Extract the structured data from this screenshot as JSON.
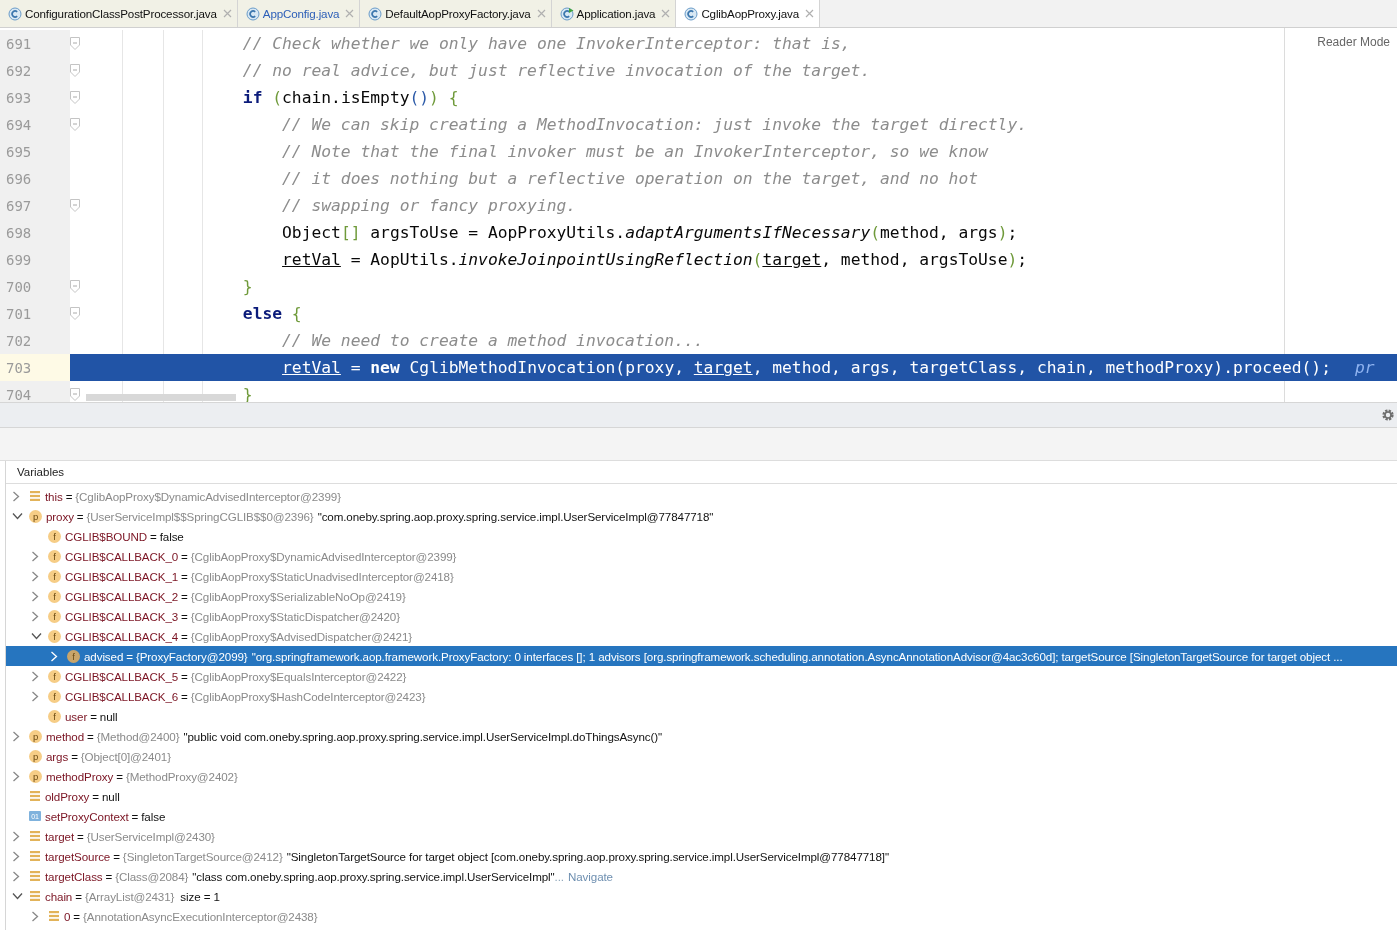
{
  "tabs": [
    {
      "label": "ConfigurationClassPostProcessor.java",
      "kind": "class",
      "modified": false,
      "selected": false
    },
    {
      "label": "AppConfig.java",
      "kind": "class",
      "modified": true,
      "selected": false
    },
    {
      "label": "DefaultAopProxyFactory.java",
      "kind": "class",
      "modified": false,
      "selected": false
    },
    {
      "label": "Application.java",
      "kind": "runnable",
      "modified": false,
      "selected": false
    },
    {
      "label": "CglibAopProxy.java",
      "kind": "class",
      "modified": false,
      "selected": true
    }
  ],
  "editor": {
    "reader_mode": "Reader Mode",
    "lines": [
      {
        "number": "691",
        "fold": true,
        "current": false,
        "tokens": [
          {
            "kind": "comment",
            "text": "                // Check whether we only have one InvokerInterceptor: that is,"
          }
        ]
      },
      {
        "number": "692",
        "fold": true,
        "current": false,
        "tokens": [
          {
            "kind": "comment",
            "text": "                // no real advice, but just reflective invocation of the target."
          }
        ]
      },
      {
        "number": "693",
        "fold": true,
        "current": false,
        "tokens": [
          {
            "kind": "keyword",
            "text": "                if"
          },
          {
            "kind": "brace",
            "text": " ("
          },
          {
            "kind": "plain",
            "text": "chain.isEmpty"
          },
          {
            "kind": "paren",
            "text": "()"
          },
          {
            "kind": "brace",
            "text": ") {"
          }
        ]
      },
      {
        "number": "694",
        "fold": true,
        "current": false,
        "tokens": [
          {
            "kind": "comment",
            "text": "                    // We can skip creating a MethodInvocation: just invoke the target directly."
          }
        ]
      },
      {
        "number": "695",
        "fold": false,
        "current": false,
        "tokens": [
          {
            "kind": "comment",
            "text": "                    // Note that the final invoker must be an InvokerInterceptor, so we know"
          }
        ]
      },
      {
        "number": "696",
        "fold": false,
        "current": false,
        "tokens": [
          {
            "kind": "comment",
            "text": "                    // it does nothing but a reflective operation on the target, and no hot"
          }
        ]
      },
      {
        "number": "697",
        "fold": true,
        "current": false,
        "tokens": [
          {
            "kind": "comment",
            "text": "                    // swapping or fancy proxying."
          }
        ]
      },
      {
        "number": "698",
        "fold": false,
        "current": false,
        "tokens": [
          {
            "kind": "plain",
            "text": "                    Object"
          },
          {
            "kind": "brace",
            "text": "[]"
          },
          {
            "kind": "plain",
            "text": " argsToUse = AopProxyUtils."
          },
          {
            "kind": "method",
            "text": "adaptArgumentsIfNecessary"
          },
          {
            "kind": "brace",
            "text": "("
          },
          {
            "kind": "plain",
            "text": "method, args"
          },
          {
            "kind": "brace",
            "text": ")"
          },
          {
            "kind": "plain",
            "text": ";"
          }
        ]
      },
      {
        "number": "699",
        "fold": false,
        "current": false,
        "tokens": [
          {
            "kind": "field",
            "text": "                    retVal"
          },
          {
            "kind": "plain",
            "text": " = AopUtils."
          },
          {
            "kind": "method",
            "text": "invokeJoinpointUsingReflection"
          },
          {
            "kind": "brace",
            "text": "("
          },
          {
            "kind": "field",
            "text": "target"
          },
          {
            "kind": "plain",
            "text": ", method, argsToUse"
          },
          {
            "kind": "brace",
            "text": ")"
          },
          {
            "kind": "plain",
            "text": ";"
          }
        ]
      },
      {
        "number": "700",
        "fold": true,
        "current": false,
        "tokens": [
          {
            "kind": "brace",
            "text": "                }"
          }
        ]
      },
      {
        "number": "701",
        "fold": true,
        "current": false,
        "tokens": [
          {
            "kind": "keyword",
            "text": "                else"
          },
          {
            "kind": "brace",
            "text": " {"
          }
        ]
      },
      {
        "number": "702",
        "fold": false,
        "current": false,
        "tokens": [
          {
            "kind": "comment",
            "text": "                    // We need to create a method invocation..."
          }
        ]
      },
      {
        "number": "703",
        "fold": false,
        "current": true,
        "tokens": [
          {
            "kind": "field",
            "text": "                    retVal"
          },
          {
            "kind": "plain",
            "text": " = "
          },
          {
            "kind": "keyword",
            "text": "new"
          },
          {
            "kind": "plain",
            "text": " CglibMethodInvocation(proxy, "
          },
          {
            "kind": "field",
            "text": "target"
          },
          {
            "kind": "plain",
            "text": ", method, args, targetClass, chain, methodProxy).proceed();"
          },
          {
            "kind": "hint",
            "text": "pr"
          }
        ]
      },
      {
        "number": "704",
        "fold": true,
        "current": false,
        "tokens": [
          {
            "kind": "brace",
            "text": "                }"
          }
        ]
      }
    ]
  },
  "variables": {
    "title": "Variables",
    "items": [
      {
        "kind": "local",
        "name": "this",
        "op": "=",
        "type": "{CglibAopProxy$DynamicAdvisedInterceptor@2399}",
        "expandable": true,
        "expanded": false,
        "selected": false
      },
      {
        "kind": "param",
        "badge": "p",
        "name": "proxy",
        "op": "=",
        "type": "{UserServiceImpl$$SpringCGLIB$$0@2396}",
        "value": "\"com.oneby.spring.aop.proxy.spring.service.impl.UserServiceImpl@77847718\"",
        "expandable": true,
        "expanded": true,
        "selected": false,
        "children": [
          {
            "kind": "field",
            "badge": "f",
            "name": "CGLIB$BOUND",
            "op": "=",
            "value": "false",
            "expandable": false,
            "selected": false
          },
          {
            "kind": "field",
            "badge": "f",
            "name": "CGLIB$CALLBACK_0",
            "op": "=",
            "type": "{CglibAopProxy$DynamicAdvisedInterceptor@2399}",
            "expandable": true,
            "expanded": false,
            "selected": false
          },
          {
            "kind": "field",
            "badge": "f",
            "name": "CGLIB$CALLBACK_1",
            "op": "=",
            "type": "{CglibAopProxy$StaticUnadvisedInterceptor@2418}",
            "expandable": true,
            "expanded": false,
            "selected": false
          },
          {
            "kind": "field",
            "badge": "f",
            "name": "CGLIB$CALLBACK_2",
            "op": "=",
            "type": "{CglibAopProxy$SerializableNoOp@2419}",
            "expandable": true,
            "expanded": false,
            "selected": false
          },
          {
            "kind": "field",
            "badge": "f",
            "name": "CGLIB$CALLBACK_3",
            "op": "=",
            "type": "{CglibAopProxy$StaticDispatcher@2420}",
            "expandable": true,
            "expanded": false,
            "selected": false
          },
          {
            "kind": "field",
            "badge": "f",
            "name": "CGLIB$CALLBACK_4",
            "op": "=",
            "type": "{CglibAopProxy$AdvisedDispatcher@2421}",
            "expandable": true,
            "expanded": true,
            "selected": false,
            "children": [
              {
                "kind": "field",
                "badge": "f",
                "name": "advised",
                "op": "=",
                "type": "{ProxyFactory@2099}",
                "value": "\"org.springframework.aop.framework.ProxyFactory: 0 interfaces []; 1 advisors [org.springframework.scheduling.annotation.AsyncAnnotationAdvisor@4ac3c60d]; targetSource [SingletonTargetSource for target object ...",
                "expandable": true,
                "expanded": false,
                "selected": true
              }
            ]
          },
          {
            "kind": "field",
            "badge": "f",
            "name": "CGLIB$CALLBACK_5",
            "op": "=",
            "type": "{CglibAopProxy$EqualsInterceptor@2422}",
            "expandable": true,
            "expanded": false,
            "selected": false
          },
          {
            "kind": "field",
            "badge": "f",
            "name": "CGLIB$CALLBACK_6",
            "op": "=",
            "type": "{CglibAopProxy$HashCodeInterceptor@2423}",
            "expandable": true,
            "expanded": false,
            "selected": false
          },
          {
            "kind": "field",
            "badge": "f",
            "name": "user",
            "op": "=",
            "value": "null",
            "expandable": false,
            "selected": false
          }
        ]
      },
      {
        "kind": "param",
        "badge": "p",
        "name": "method",
        "op": "=",
        "type": "{Method@2400}",
        "value": "\"public void com.oneby.spring.aop.proxy.spring.service.impl.UserServiceImpl.doThingsAsync()\"",
        "expandable": true,
        "expanded": false,
        "selected": false
      },
      {
        "kind": "param",
        "badge": "p",
        "name": "args",
        "op": "=",
        "type": "{Object[0]@2401}",
        "expandable": false,
        "selected": false
      },
      {
        "kind": "param",
        "badge": "p",
        "name": "methodProxy",
        "op": "=",
        "type": "{MethodProxy@2402}",
        "expandable": true,
        "expanded": false,
        "selected": false
      },
      {
        "kind": "local",
        "name": "oldProxy",
        "op": "=",
        "value": "null",
        "expandable": false,
        "selected": false
      },
      {
        "kind": "bool",
        "badge": "01",
        "name": "setProxyContext",
        "op": "=",
        "value": "false",
        "expandable": false,
        "selected": false
      },
      {
        "kind": "local",
        "name": "target",
        "op": "=",
        "type": "{UserServiceImpl@2430}",
        "expandable": true,
        "expanded": false,
        "selected": false
      },
      {
        "kind": "local",
        "name": "targetSource",
        "op": "=",
        "type": "{SingletonTargetSource@2412}",
        "value": "\"SingletonTargetSource for target object [com.oneby.spring.aop.proxy.spring.service.impl.UserServiceImpl@77847718]\"",
        "expandable": true,
        "expanded": false,
        "selected": false
      },
      {
        "kind": "local",
        "name": "targetClass",
        "op": "=",
        "type": "{Class@2084}",
        "value": "\"class com.oneby.spring.aop.proxy.spring.service.impl.UserServiceImpl\"",
        "more": "...",
        "link": "Navigate",
        "expandable": true,
        "expanded": false,
        "selected": false
      },
      {
        "kind": "local",
        "name": "chain",
        "op": "=",
        "type": "{ArrayList@2431}",
        "extra": "size = 1",
        "expandable": true,
        "expanded": true,
        "selected": false,
        "children": [
          {
            "kind": "local",
            "name": "0",
            "op": "=",
            "type": "{AnnotationAsyncExecutionInterceptor@2438}",
            "expandable": true,
            "expanded": false,
            "selected": false
          }
        ]
      }
    ]
  }
}
